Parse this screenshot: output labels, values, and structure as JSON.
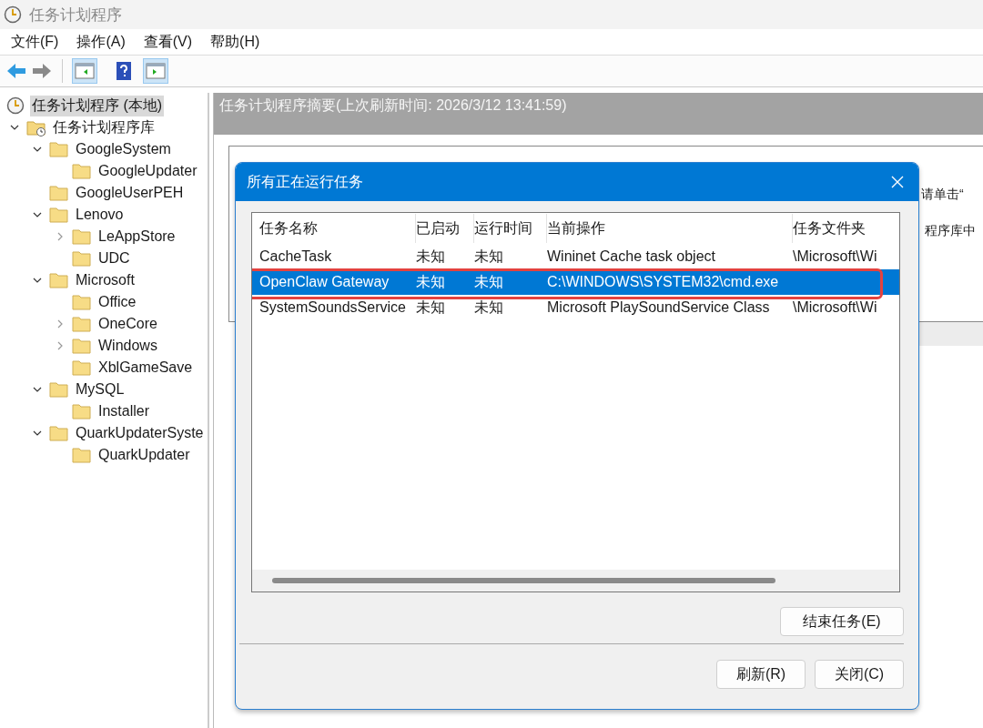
{
  "window": {
    "title": "任务计划程序"
  },
  "menu": [
    "文件(F)",
    "操作(A)",
    "查看(V)",
    "帮助(H)"
  ],
  "toolbar": [
    {
      "kind": "back",
      "disabled": false
    },
    {
      "kind": "forward",
      "disabled": true
    },
    {
      "kind": "sep"
    },
    {
      "kind": "pane-left",
      "selected": true
    },
    {
      "kind": "help"
    },
    {
      "kind": "pane-right",
      "selected": true
    }
  ],
  "tree": [
    {
      "label": "任务计划程序 (本地)",
      "kind": "computer",
      "selected": true,
      "children": [
        {
          "label": "任务计划程序库",
          "kind": "library",
          "selected": false,
          "expanded": true,
          "children": [
            {
              "label": "GoogleSystem",
              "kind": "folder",
              "selected": false,
              "expanded": true,
              "children": [
                {
                  "label": "GoogleUpdater",
                  "kind": "folder",
                  "selected": false
                }
              ]
            },
            {
              "label": "GoogleUserPEH",
              "kind": "folder",
              "selected": false
            },
            {
              "label": "Lenovo",
              "kind": "folder",
              "selected": false,
              "expanded": true,
              "children": [
                {
                  "label": "LeAppStore",
                  "kind": "folder",
                  "selected": false,
                  "expanded": false
                },
                {
                  "label": "UDC",
                  "kind": "folder",
                  "selected": false
                }
              ]
            },
            {
              "label": "Microsoft",
              "kind": "folder",
              "selected": false,
              "expanded": true,
              "children": [
                {
                  "label": "Office",
                  "kind": "folder",
                  "selected": false
                },
                {
                  "label": "OneCore",
                  "kind": "folder",
                  "selected": false,
                  "expanded": false
                },
                {
                  "label": "Windows",
                  "kind": "folder",
                  "selected": false,
                  "expanded": false
                },
                {
                  "label": "XblGameSave",
                  "kind": "folder",
                  "selected": false
                }
              ]
            },
            {
              "label": "MySQL",
              "kind": "folder",
              "selected": false,
              "expanded": true,
              "children": [
                {
                  "label": "Installer",
                  "kind": "folder",
                  "selected": false
                }
              ]
            },
            {
              "label": "QuarkUpdaterSyste",
              "kind": "folder",
              "selected": false,
              "expanded": true,
              "children": [
                {
                  "label": "QuarkUpdater",
                  "kind": "folder",
                  "selected": false
                }
              ]
            }
          ]
        }
      ]
    }
  ],
  "summary": {
    "header": "任务计划程序摘要(上次刷新时间: 2026/3/12 13:41:59)",
    "text_1": "请单击“",
    "text_2": "程序库中"
  },
  "dialog": {
    "title": "所有正在运行任务",
    "columns": [
      "任务名称",
      "已启动",
      "运行时间",
      "当前操作",
      "任务文件夹"
    ],
    "rows": [
      {
        "cells": [
          "CacheTask",
          "未知",
          "未知",
          "Wininet Cache task object",
          "\\Microsoft\\Wi"
        ],
        "selected": false,
        "annotated": false
      },
      {
        "cells": [
          "OpenClaw Gateway",
          "未知",
          "未知",
          "C:\\WINDOWS\\SYSTEM32\\cmd.exe"
        ],
        "selected": true,
        "annotated": true
      },
      {
        "cells": [
          "SystemSoundsService",
          "未知",
          "未知",
          "Microsoft PlaySoundService Class",
          "\\Microsoft\\Wi"
        ],
        "selected": false,
        "annotated": false
      }
    ],
    "end_button": "结束任务(E)",
    "refresh_button": "刷新(R)",
    "close_button": "关闭(C)"
  }
}
